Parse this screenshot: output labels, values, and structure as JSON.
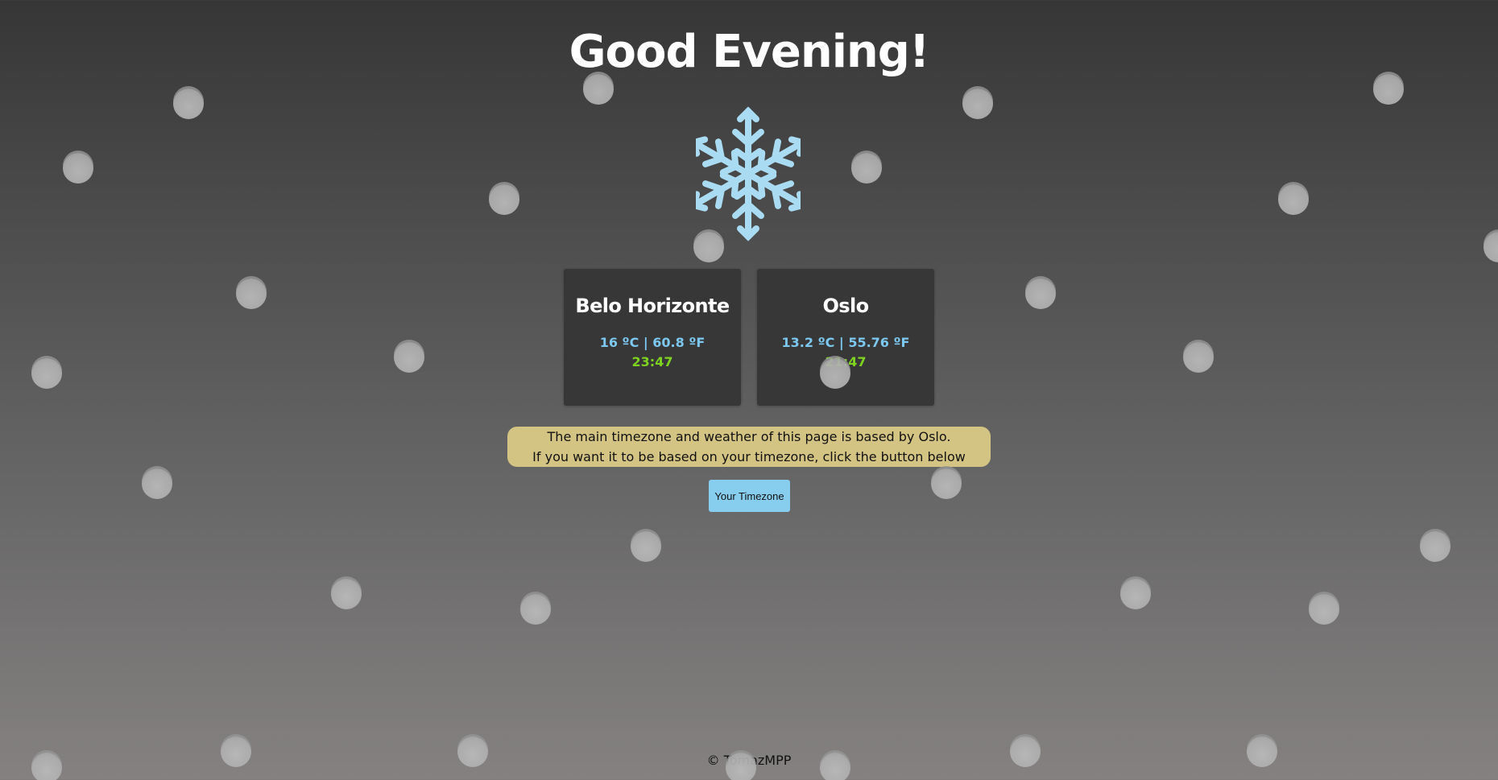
{
  "greeting": "Good Evening!",
  "weather_icon": "snowflake-icon",
  "cities": [
    {
      "name": "Belo Horizonte",
      "temperature": "16 ºC | 60.8 ºF",
      "time": "23:47"
    },
    {
      "name": "Oslo",
      "temperature": "13.2 ºC | 55.76 ºF",
      "time": "21:47"
    }
  ],
  "notice": {
    "line1": "The main timezone and weather of this page is based by Oslo.",
    "line2": "If you want it to be based on your timezone, click the button below"
  },
  "timezone_button_label": "Your Timezone",
  "footer": "© TomazMPP",
  "colors": {
    "temperature": "#7cc8f0",
    "time": "#7ed321",
    "notice_background": "#d4c484",
    "button_background": "#87cdee",
    "card_background": "#373737"
  }
}
